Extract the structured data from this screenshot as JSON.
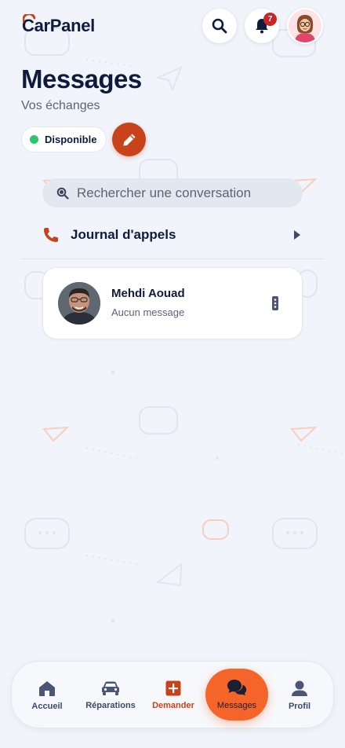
{
  "header": {
    "logo_text": "arPanel",
    "logo_initial": "C",
    "notification_count": "7"
  },
  "page": {
    "title": "Messages",
    "subtitle": "Vos échanges",
    "status_label": "Disponible"
  },
  "search": {
    "placeholder": "Rechercher une conversation"
  },
  "call_log": {
    "label": "Journal d'appels"
  },
  "conversations": [
    {
      "name": "Mehdi Aouad",
      "last_message": "Aucun message"
    }
  ],
  "nav": {
    "items": [
      {
        "label": "Accueil",
        "icon": "home-icon"
      },
      {
        "label": "Réparations",
        "icon": "car-icon"
      },
      {
        "label": "Demander",
        "icon": "plus-square-icon"
      },
      {
        "label": "Messages",
        "icon": "chat-icon"
      },
      {
        "label": "Profil",
        "icon": "user-icon"
      }
    ]
  },
  "colors": {
    "accent": "#c8431a",
    "active_tab": "#f5652a",
    "status_online": "#2ec46b",
    "badge": "#c62626",
    "navy": "#0f1b3d"
  }
}
